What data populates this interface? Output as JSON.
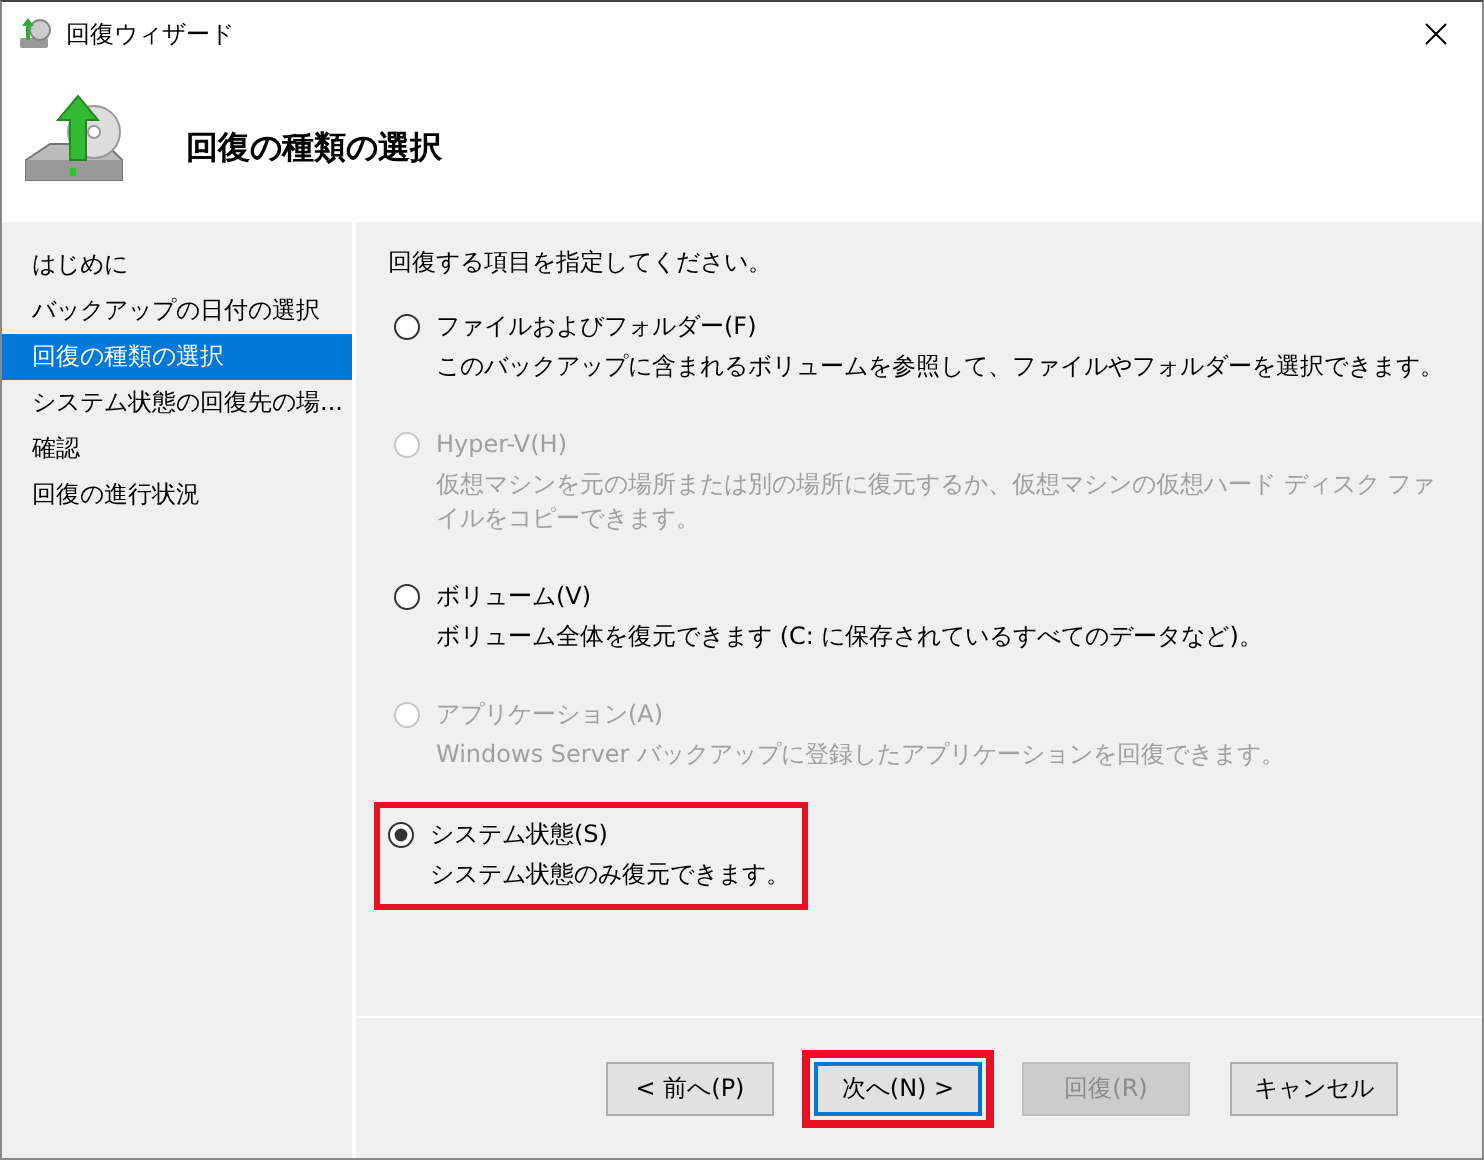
{
  "window": {
    "title": "回復ウィザード"
  },
  "header": {
    "title": "回復の種類の選択"
  },
  "sidebar": {
    "items": [
      {
        "label": "はじめに",
        "selected": false
      },
      {
        "label": "バックアップの日付の選択",
        "selected": false
      },
      {
        "label": "回復の種類の選択",
        "selected": true
      },
      {
        "label": "システム状態の回復先の場...",
        "selected": false
      },
      {
        "label": "確認",
        "selected": false
      },
      {
        "label": "回復の進行状況",
        "selected": false
      }
    ]
  },
  "content": {
    "prompt": "回復する項目を指定してください。",
    "options": [
      {
        "label": "ファイルおよびフォルダー(F)",
        "description": "このバックアップに含まれるボリュームを参照して、ファイルやフォルダーを選択できます。",
        "selected": false,
        "disabled": false,
        "highlighted": false
      },
      {
        "label": "Hyper-V(H)",
        "description": "仮想マシンを元の場所または別の場所に復元するか、仮想マシンの仮想ハード ディスク ファイルをコピーできます。",
        "selected": false,
        "disabled": true,
        "highlighted": false
      },
      {
        "label": "ボリューム(V)",
        "description": "ボリューム全体を復元できます (C: に保存されているすべてのデータなど)。",
        "selected": false,
        "disabled": false,
        "highlighted": false
      },
      {
        "label": "アプリケーション(A)",
        "description": "Windows Server バックアップに登録したアプリケーションを回復できます。",
        "selected": false,
        "disabled": true,
        "highlighted": false
      },
      {
        "label": "システム状態(S)",
        "description": "システム状態のみ復元できます。",
        "selected": true,
        "disabled": false,
        "highlighted": true
      }
    ]
  },
  "buttons": [
    {
      "label": "< 前へ(P)",
      "disabled": false,
      "focused": false,
      "highlighted": false
    },
    {
      "label": "次へ(N) >",
      "disabled": false,
      "focused": true,
      "highlighted": true
    },
    {
      "label": "回復(R)",
      "disabled": true,
      "focused": false,
      "highlighted": false
    },
    {
      "label": "キャンセル",
      "disabled": false,
      "focused": false,
      "highlighted": false
    }
  ]
}
